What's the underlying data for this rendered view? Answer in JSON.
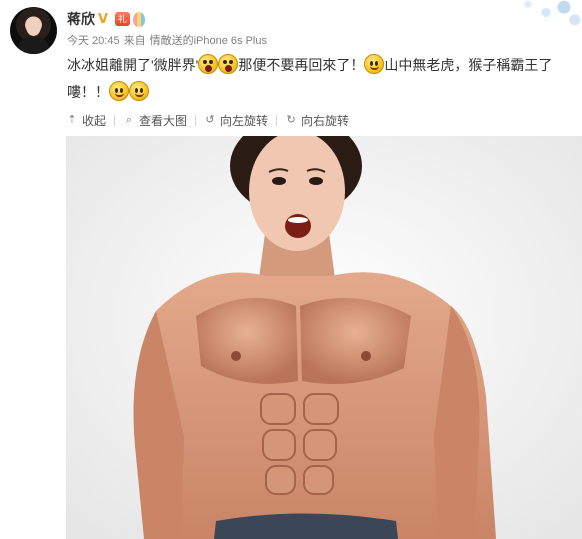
{
  "post": {
    "author": "蒋欣",
    "time": "今天 20:45",
    "source_prefix": "来自",
    "source": "情敵送的iPhone 6s Plus",
    "text_parts": [
      "冰冰姐離開了'微胖界'",
      "那便不要再回來了！",
      "山中無老虎，猴子稱霸王了嘍！！"
    ],
    "emojis": [
      "wow-face",
      "wow-face",
      "smile-face",
      "smile-face",
      "smile-face"
    ]
  },
  "badges": {
    "verified": "V",
    "gift": "礼"
  },
  "toolbar": {
    "collapse": "收起",
    "view_large": "查看大图",
    "rotate_left": "向左旋转",
    "rotate_right": "向右旋转"
  },
  "icons": {
    "collapse": "collapse-up-icon",
    "view_large": "magnifier-icon",
    "rotate_left": "rotate-left-icon",
    "rotate_right": "rotate-right-icon"
  },
  "colors": {
    "name": "#333333",
    "meta": "#808080",
    "toolbar": "#555555",
    "verified": "#f0a21e"
  }
}
